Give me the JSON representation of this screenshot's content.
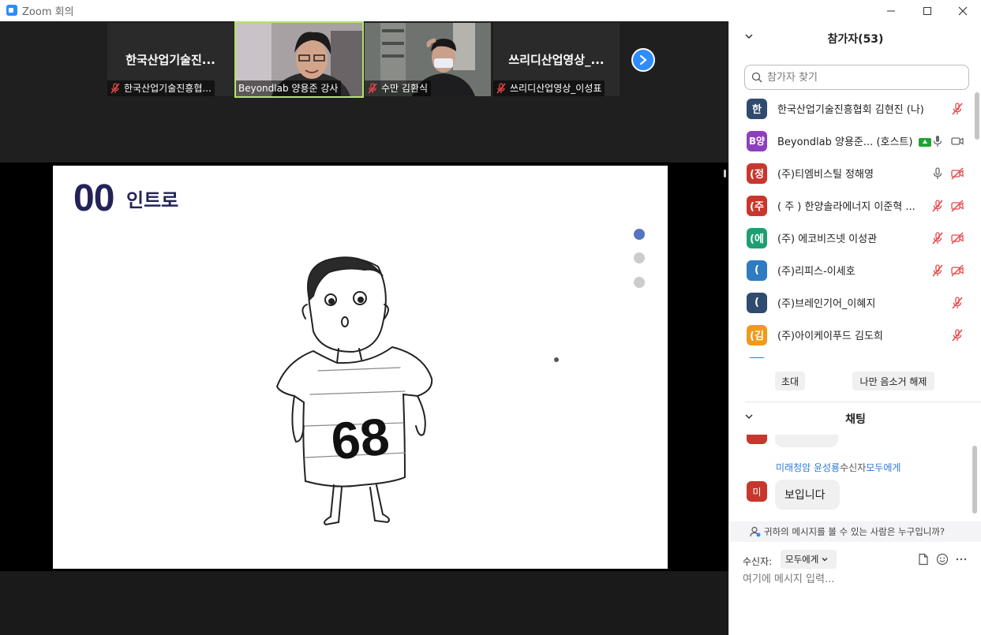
{
  "window": {
    "title": "Zoom 회의",
    "minimize": "—",
    "maximize": "☐",
    "close": "✕"
  },
  "videos": [
    {
      "name": "한국산업기술진...",
      "caption": "한국산업기술진흥협...",
      "muted": true
    },
    {
      "name": "",
      "caption": "Beyondlab 양용준 강사",
      "muted": false
    },
    {
      "name": "",
      "caption": "수만 김환식",
      "muted": true
    },
    {
      "name": "쓰리디산업영상_...",
      "caption": "쓰리디산업영상_이성표",
      "muted": true
    }
  ],
  "slide": {
    "number": "00",
    "title": "인트로",
    "shirt_number": "68",
    "dots": 3,
    "active_dot": 0
  },
  "participants": {
    "header": "참가자(53)",
    "search_placeholder": "참가자 찾기",
    "list": [
      {
        "avatar": "한",
        "color": "#2f4b6e",
        "name": "한국산업기술진흥협회 김현진 (나)",
        "mic": "muted",
        "video": "none"
      },
      {
        "avatar": "B양",
        "color": "#8e3fbe",
        "name": "Beyondlab 양용준...",
        "host": "(호스트)",
        "sharing": true,
        "mic": "on",
        "video": "on"
      },
      {
        "avatar": "(정",
        "color": "#c8372d",
        "name": "(주)티엠비스틸 정해영",
        "mic": "on",
        "video": "off"
      },
      {
        "avatar": "(주",
        "color": "#c8372d",
        "name": "( 주 ) 한양솔라에너지 이준혁 ...",
        "mic": "muted",
        "video": "off"
      },
      {
        "avatar": "(에",
        "color": "#1f9e74",
        "name": "(주) 에코비즈넷 이성관",
        "mic": "muted",
        "video": "off"
      },
      {
        "avatar": "(",
        "color": "#2f7cc0",
        "name": "(주)리피스-이세호",
        "mic": "muted",
        "video": "off"
      },
      {
        "avatar": "(",
        "color": "#2f4b6e",
        "name": "(주)브레인기어_이혜지",
        "mic": "muted",
        "video": "none"
      },
      {
        "avatar": "(김",
        "color": "#ef9a1b",
        "name": "(주)아이케이푸드 김도희",
        "mic": "muted",
        "video": "none"
      }
    ],
    "invite_button": "초대",
    "unmute_button": "나만 음소거 해제"
  },
  "chat": {
    "header": "채팅",
    "messages": [
      {
        "sender": "미래청암 윤성룡",
        "to_label": "수신자",
        "to": "모두에게",
        "avatar": "미",
        "text": "보입니다"
      }
    ],
    "who_can_see": "귀하의 메시지를 볼 수 있는 사람은 누구입니까?",
    "recipient_label": "수신자:",
    "recipient_value": "모두에게",
    "input_placeholder": "여기에 메시지 입력..."
  }
}
